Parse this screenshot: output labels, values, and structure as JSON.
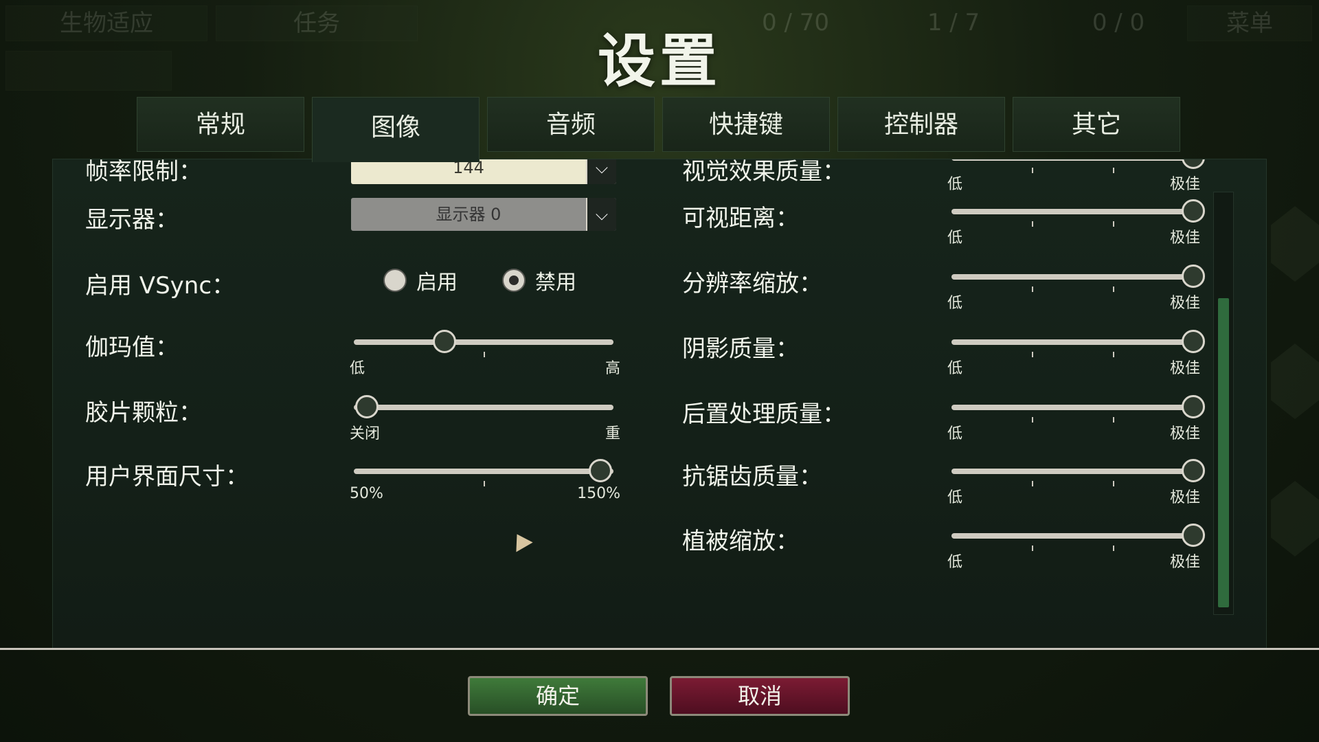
{
  "hud": {
    "left_box": "生物适应",
    "tasks": "任务",
    "count1": "0 / 70",
    "count2": "1 / 7",
    "count3": "0 / 0",
    "menu": "菜单"
  },
  "title": "设置",
  "tabs": [
    {
      "label": "常规",
      "active": false
    },
    {
      "label": "图像",
      "active": true
    },
    {
      "label": "音频",
      "active": false
    },
    {
      "label": "快捷键",
      "active": false
    },
    {
      "label": "控制器",
      "active": false
    },
    {
      "label": "其它",
      "active": false
    }
  ],
  "left": {
    "framerate": {
      "label": "帧率限制：",
      "value": "144"
    },
    "display": {
      "label": "显示器：",
      "value": "显示器 0"
    },
    "vsync": {
      "label": "启用 VSync：",
      "on": "启用",
      "off": "禁用",
      "selected": "off"
    },
    "gamma": {
      "label": "伽玛值：",
      "min": "低",
      "max": "高",
      "value": 0.35
    },
    "film_grain": {
      "label": "胶片颗粒：",
      "min": "关闭",
      "max": "重",
      "value": 0.05
    },
    "ui_size": {
      "label": "用户界面尺寸：",
      "min": "50%",
      "max": "150%",
      "value": 0.95
    }
  },
  "right": {
    "visual_quality": {
      "label": "视觉效果质量：",
      "min": "低",
      "max": "极佳",
      "value": 1.0
    },
    "view_distance": {
      "label": "可视距离：",
      "min": "低",
      "max": "极佳",
      "value": 1.0
    },
    "resolution_scale": {
      "label": "分辨率缩放：",
      "min": "低",
      "max": "极佳",
      "value": 1.0
    },
    "shadow_quality": {
      "label": "阴影质量：",
      "min": "低",
      "max": "极佳",
      "value": 1.0
    },
    "post_processing": {
      "label": "后置处理质量：",
      "min": "低",
      "max": "极佳",
      "value": 1.0
    },
    "antialiasing": {
      "label": "抗锯齿质量：",
      "min": "低",
      "max": "极佳",
      "value": 1.0
    },
    "vegetation_scale": {
      "label": "植被缩放：",
      "min": "低",
      "max": "极佳",
      "value": 1.0
    }
  },
  "buttons": {
    "ok": "确定",
    "cancel": "取消"
  },
  "colors": {
    "ok": "#3f7a3a",
    "cancel": "#7b1b33",
    "panel": "#16241b"
  }
}
